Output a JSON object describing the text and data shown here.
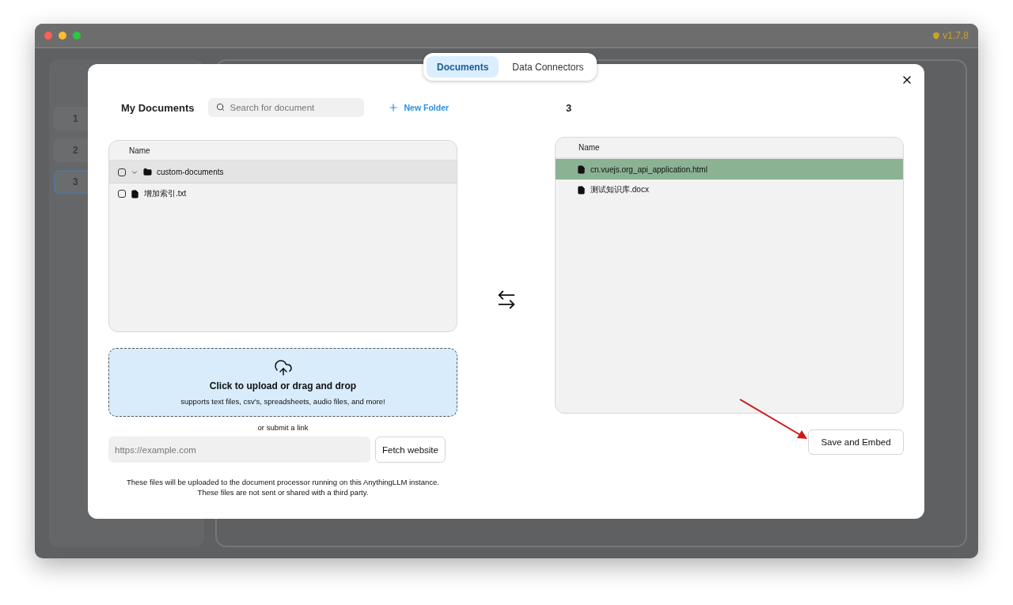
{
  "window": {
    "version": "v1.7.8"
  },
  "sidebar": {
    "workspaces": [
      {
        "name": "1",
        "selected": false
      },
      {
        "name": "2",
        "selected": false
      },
      {
        "name": "3",
        "selected": true
      }
    ]
  },
  "tabs": [
    {
      "label": "Documents",
      "selected": true
    },
    {
      "label": "Data Connectors",
      "selected": false
    }
  ],
  "my_documents": {
    "title": "My Documents",
    "search": {
      "placeholder": "Search for document"
    },
    "new_folder": "New Folder",
    "table": {
      "columns": [
        "Name"
      ],
      "rows": [
        {
          "kind": "folder",
          "name": "custom-documents",
          "checked": false,
          "selected": true
        },
        {
          "kind": "file",
          "name": "增加索引.txt",
          "checked": false,
          "selected": false
        }
      ]
    }
  },
  "upload": {
    "title": "Click to upload or drag and drop",
    "subtitle": "supports text files, csv's, spreadsheets, audio files, and more!"
  },
  "link": {
    "label": "or submit a link",
    "placeholder": "https://example.com",
    "button": "Fetch website"
  },
  "notice": [
    "These files will be uploaded to the document processor running on this AnythingLLM instance.",
    "These files are not sent or shared with a third party."
  ],
  "workspace": {
    "name": "3",
    "table": {
      "columns": [
        "Name"
      ],
      "rows": [
        {
          "kind": "file",
          "name": "cn.vuejs.org_api_application.html",
          "selected": true
        },
        {
          "kind": "file",
          "name": "测试知识库.docx",
          "selected": false
        }
      ]
    },
    "save_button": "Save and Embed"
  }
}
